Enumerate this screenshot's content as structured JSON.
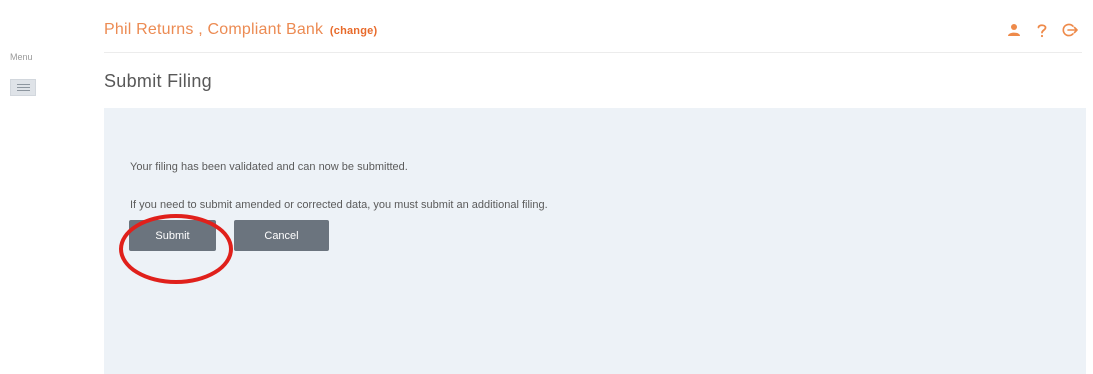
{
  "menu": {
    "label": "Menu",
    "icon": "hamburger-icon"
  },
  "header": {
    "org_name": "Phil Returns , Compliant Bank",
    "change_link": "(change)",
    "icons": [
      "user-icon",
      "help-icon",
      "logout-icon"
    ],
    "accent_color": "#ec8b53"
  },
  "page": {
    "title": "Submit Filing"
  },
  "panel": {
    "message_1": "Your filing has been validated and can now be submitted.",
    "message_2": "If you need to submit amended or corrected data, you must submit an additional filing.",
    "submit_label": "Submit",
    "cancel_label": "Cancel",
    "background_color": "#edf2f7"
  },
  "annotation": {
    "color": "#e0201b",
    "target": "submit-button"
  }
}
